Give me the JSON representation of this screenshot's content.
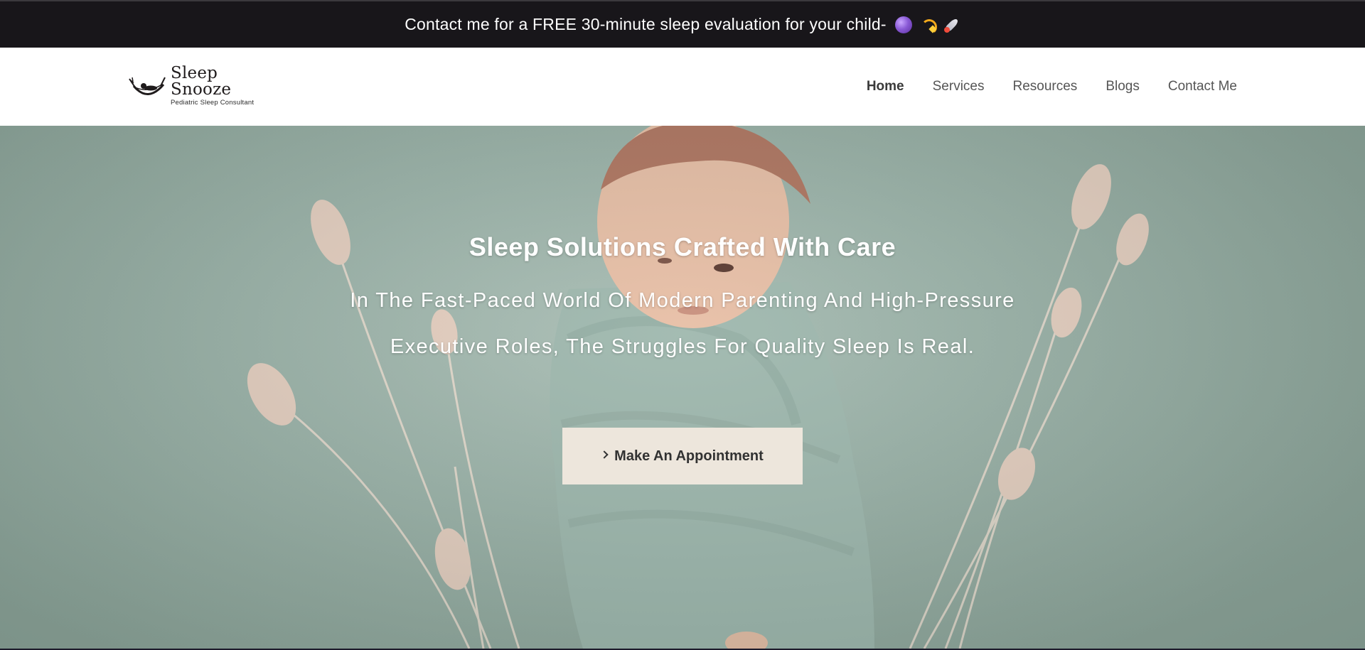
{
  "announcement": {
    "text": "Contact me for a FREE 30‑minute sleep evaluation for your child‑",
    "emojis": [
      "moon-emoji",
      "dizzy-emoji",
      "rocket-emoji"
    ]
  },
  "logo": {
    "title": "Sleep Snooze",
    "subtitle": "Pediatric Sleep Consultant",
    "icon": "hammock-baby-icon"
  },
  "nav": {
    "items": [
      {
        "label": "Home",
        "active": true
      },
      {
        "label": "Services",
        "active": false
      },
      {
        "label": "Resources",
        "active": false
      },
      {
        "label": "Blogs",
        "active": false
      },
      {
        "label": "Contact Me",
        "active": false
      }
    ]
  },
  "hero": {
    "title": "Sleep Solutions Crafted With Care",
    "subtitle_line1": "In The Fast‑Paced World Of Modern Parenting And High‑Pressure",
    "subtitle_line2": "Executive Roles, The Struggles For Quality Sleep Is Real.",
    "cta_label": "Make An Appointment",
    "image": "swaddled-newborn-with-bunny-tail-grass-photo"
  },
  "colors": {
    "announce_bg": "#18161a",
    "hero_bg": "#9cb3a9",
    "cta_bg": "#ede6dc",
    "nav_text": "#555555"
  }
}
